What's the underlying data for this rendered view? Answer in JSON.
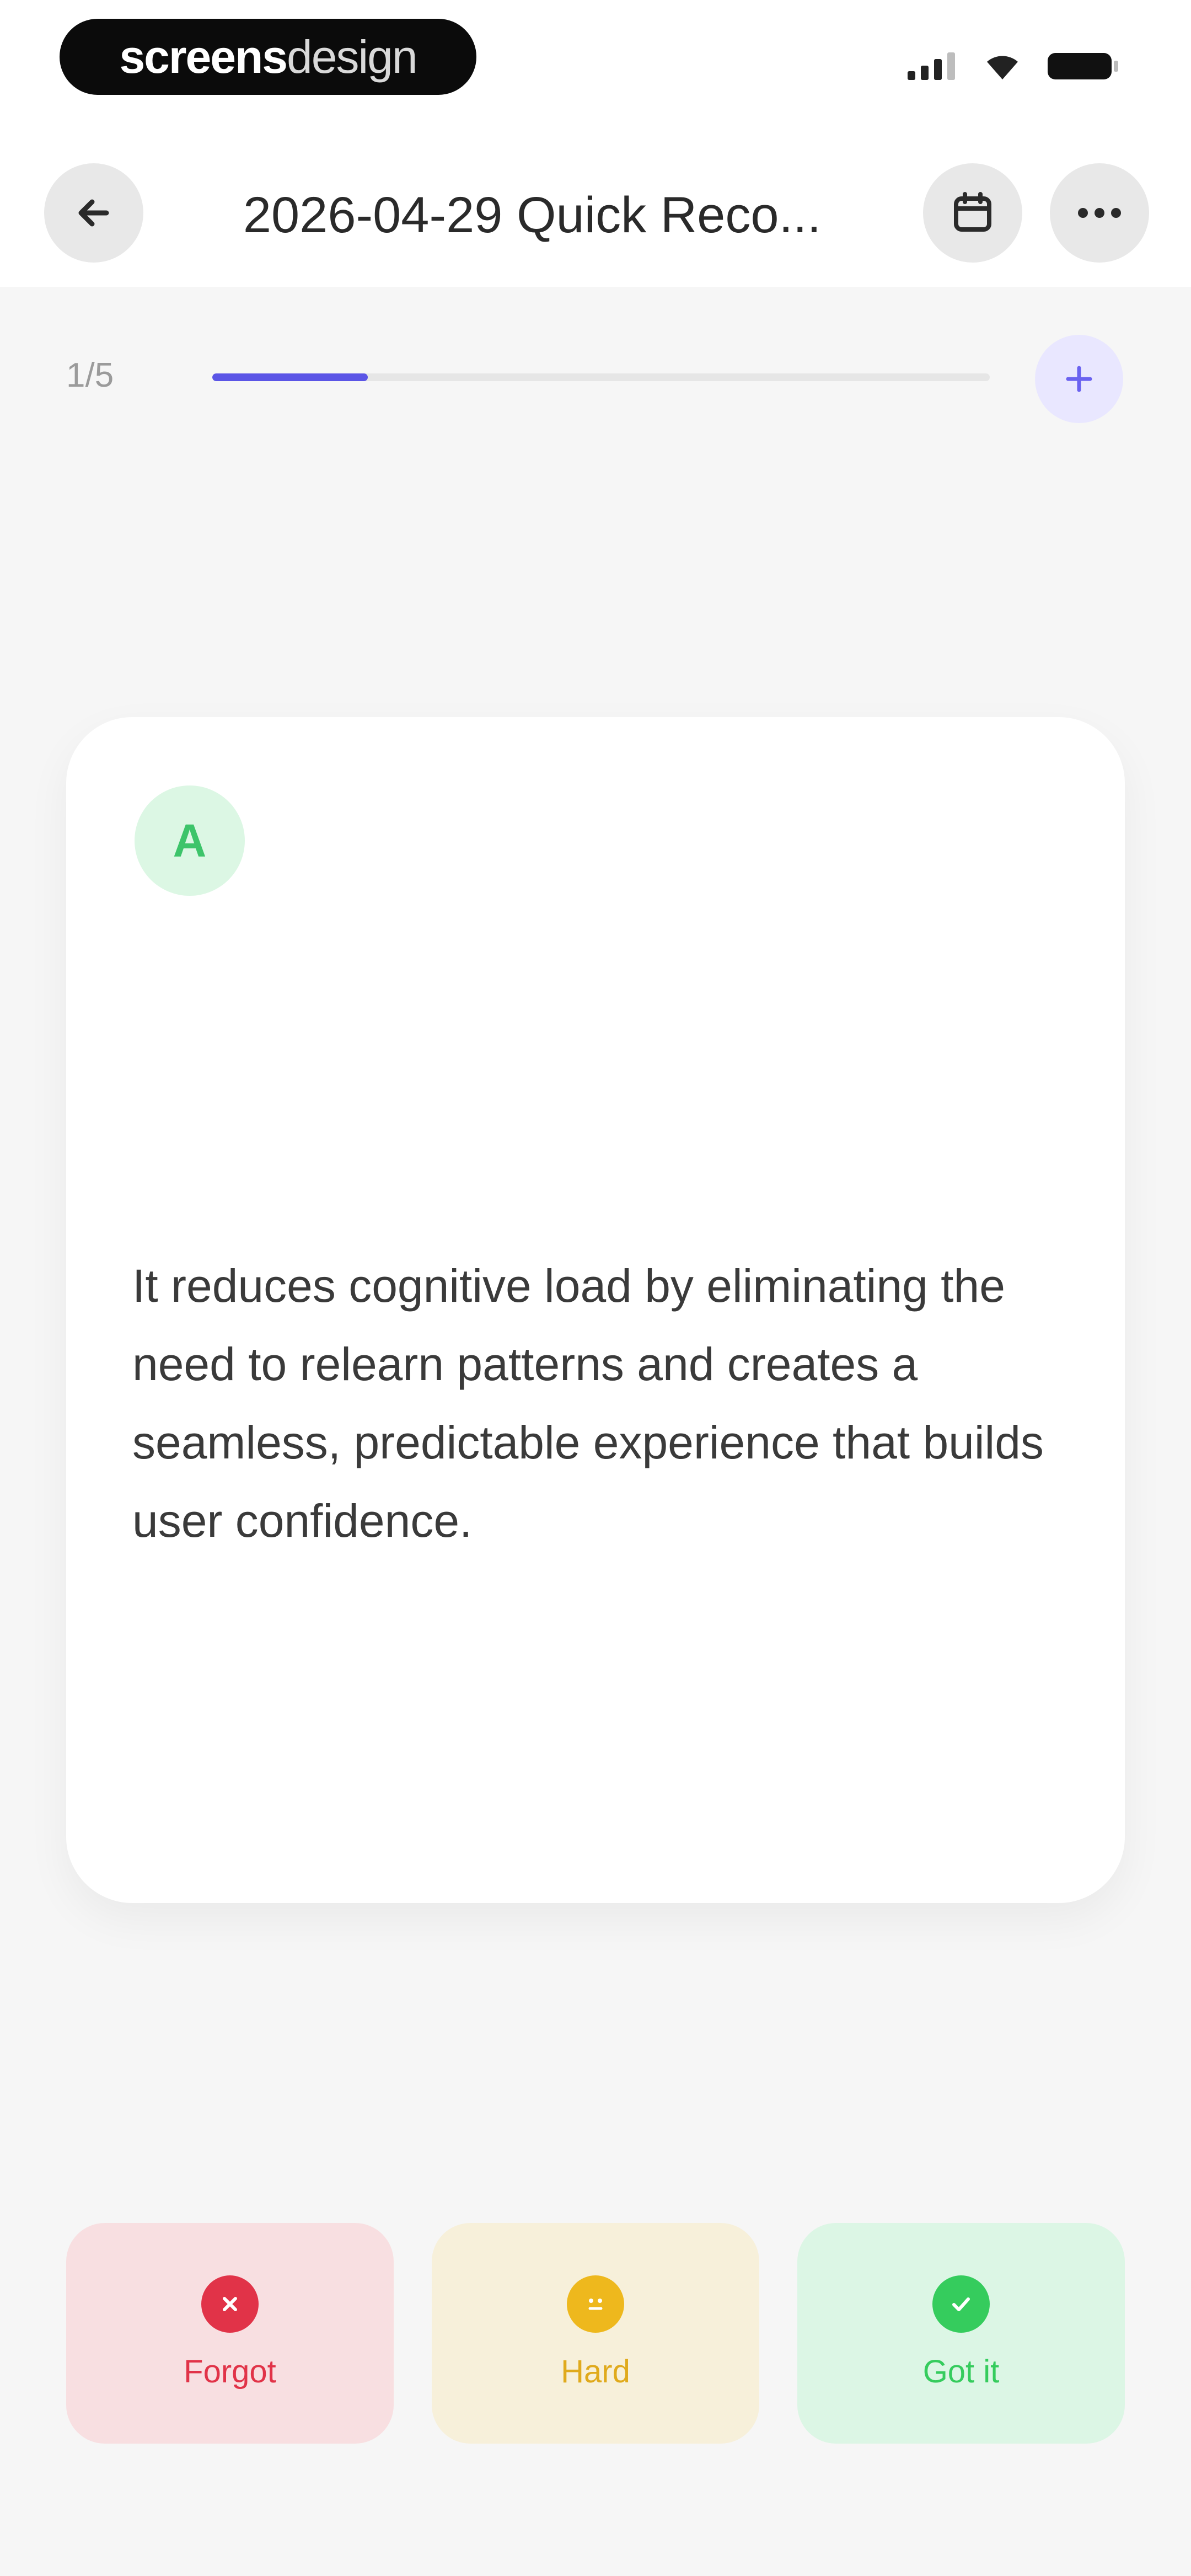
{
  "status_bar": {
    "brand_bold": "screens",
    "brand_light": "design",
    "icons": [
      "signal-icon",
      "wifi-icon",
      "battery-icon"
    ]
  },
  "header": {
    "title": "2026-04-29 Quick Reco...",
    "icons": {
      "back": "arrow-left-icon",
      "calendar": "calendar-icon",
      "more": "more-horizontal-icon"
    }
  },
  "progress": {
    "label": "1/5",
    "current": 1,
    "total": 5,
    "add_icon": "plus-icon"
  },
  "card": {
    "badge": "A",
    "answer": "It reduces cognitive load by eliminating the need to relearn patterns and creates a seamless, predictable experience that builds user confidence."
  },
  "ratings": {
    "forgot": "Forgot",
    "hard": "Hard",
    "got_it": "Got it"
  },
  "colors": {
    "accent": "#5b55e6",
    "forgot": "#e13348",
    "hard": "#eeb81d",
    "got_it": "#35cc5d"
  }
}
